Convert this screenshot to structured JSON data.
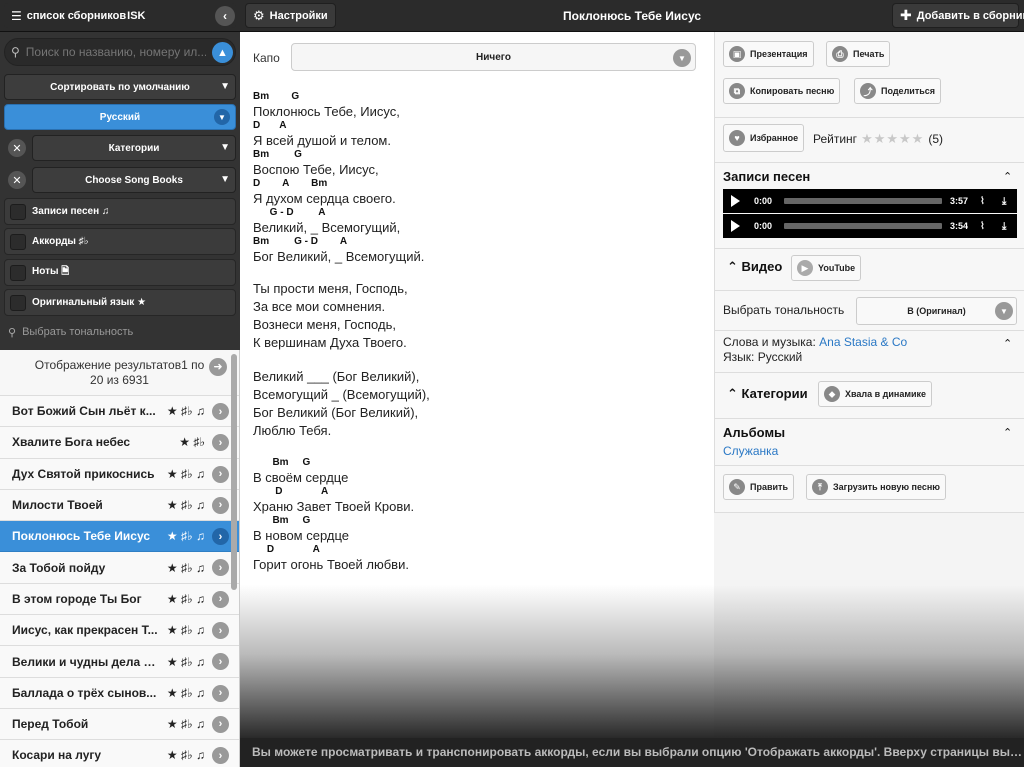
{
  "topbar": {
    "songbooks_label": "список сборников",
    "songbooks_suffix": "ISK",
    "settings_label": "Настройки",
    "title": "Поклонюсь Тебе Иисус",
    "add_label": "Добавить в сборник"
  },
  "sidebar": {
    "search_placeholder": "Поиск по названию, номеру ил...",
    "sort_label": "Сортировать по умолчанию",
    "language_label": "Русский",
    "categories_label": "Категории",
    "songbooks_label": "Choose Song Books",
    "filters": [
      {
        "label": "Записи песен ♫"
      },
      {
        "label": "Аккорды ♯♭"
      },
      {
        "label": "Ноты 🗎"
      },
      {
        "label": "Оригинальный язык ★"
      }
    ],
    "key_placeholder": "Выбрать тональность"
  },
  "results": {
    "header": "Отображение результатов1 по 20 из 6931",
    "items": [
      {
        "name": "Вот Божий Сын льёт к...",
        "icons": "★ ♯♭ ♫"
      },
      {
        "name": "Хвалите Бога небес",
        "icons": "★ ♯♭"
      },
      {
        "name": "Дух Святой прикоснись",
        "icons": "★ ♯♭ ♫"
      },
      {
        "name": "Милости Твоей",
        "icons": "★ ♯♭ ♫"
      },
      {
        "name": "Поклонюсь Тебе Иисус",
        "icons": "★ ♯♭ ♫"
      },
      {
        "name": "За Тобой пойду",
        "icons": "★ ♯♭ ♫"
      },
      {
        "name": "В этом городе Ты Бог",
        "icons": "★ ♯♭ ♫"
      },
      {
        "name": "Иисус, как прекрасен Т...",
        "icons": "★ ♯♭ ♫"
      },
      {
        "name": "Велики и чудны дела Т...",
        "icons": "★ ♯♭ ♫"
      },
      {
        "name": "Баллада о трёх сынов...",
        "icons": "★ ♯♭ ♫"
      },
      {
        "name": "Перед Тобой",
        "icons": "★ ♯♭ ♫"
      },
      {
        "name": "Косари на лугу",
        "icons": "★ ♯♭ ♫"
      }
    ]
  },
  "main": {
    "capo_label": "Капо",
    "capo_value": "Ничего",
    "lyrics": [
      {
        "c": "Bm        G",
        "t": "Поклонюсь Тебе, Иисус,"
      },
      {
        "c": "D       A",
        "t": "Я всей душой и телом."
      },
      {
        "c": "Bm         G",
        "t": "Воспою Тебе, Иисус,"
      },
      {
        "c": "D        A        Bm",
        "t": "Я духом сердца своего."
      },
      {
        "c": "      G - D         A",
        "t": "Великий, _ Всемогущий,"
      },
      {
        "c": "Bm         G - D        A",
        "t": "Бог Великий, _ Всемогущий."
      },
      {
        "gap": true
      },
      {
        "t": "Ты прости меня, Господь,"
      },
      {
        "t": "За все мои сомнения."
      },
      {
        "t": "Вознеси меня, Господь,"
      },
      {
        "t": "К вершинам Духа Твоего."
      },
      {
        "gap": true
      },
      {
        "t": "Великий ___ (Бог Великий),"
      },
      {
        "t": "Всемогущий _ (Всемогущий),"
      },
      {
        "t": "Бог Великий (Бог Великий),"
      },
      {
        "t": "Люблю Тебя."
      },
      {
        "gap": true
      },
      {
        "c": "       Bm     G",
        "t": "В своём сердце"
      },
      {
        "c": "        D              A",
        "t": "Храню Завет Твоей Крови."
      },
      {
        "c": "       Bm     G",
        "t": "В новом сердце"
      },
      {
        "c": "     D              A",
        "t": "Горит огонь Твоей любви."
      }
    ]
  },
  "right": {
    "presentation": "Презентация",
    "print": "Печать",
    "copy": "Копировать песню",
    "share": "Поделиться",
    "favorite": "Избранное",
    "rating_label": "Рейтинг",
    "rating_count": "(5)",
    "recordings_title": "Записи песен",
    "players": [
      {
        "time": "0:00",
        "duration": "3:57"
      },
      {
        "time": "0:00",
        "duration": "3:54"
      }
    ],
    "video_title": "Видео",
    "youtube_label": "YouTube",
    "key_label": "Выбрать тональность",
    "key_value": "В (Оригинал)",
    "words_label": "Слова и музыка:",
    "author": "Ana Stasia & Co",
    "language_line": "Язык: Русский",
    "categories_title": "Категории",
    "category_item": "Хвала в динамике",
    "albums_title": "Альбомы",
    "album_item": "Служанка",
    "edit_label": "Править",
    "upload_label": "Загрузить новую песню"
  },
  "toast": "Вы можете просматривать и транспонировать аккорды, если вы выбрали опцию 'Отображать аккорды'. Вверху страницы выберите тональность."
}
